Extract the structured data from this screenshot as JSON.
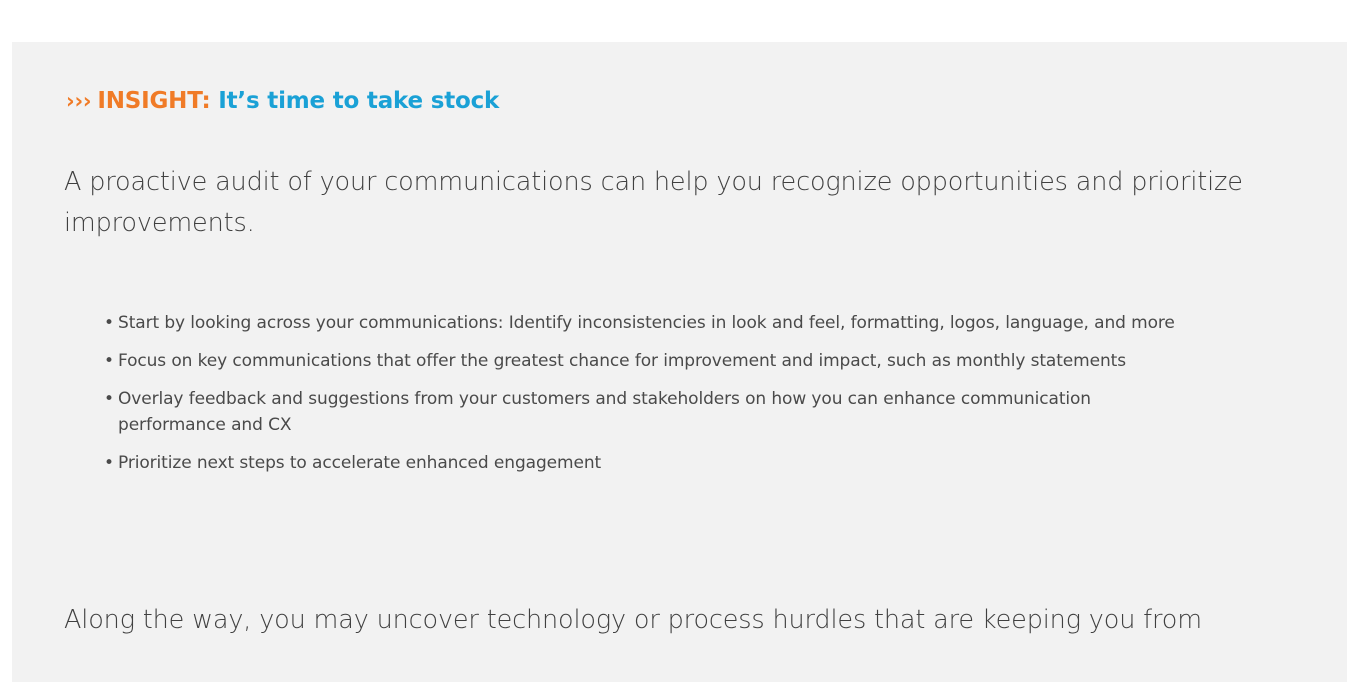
{
  "insight": {
    "chevrons": "›››",
    "label": "INSIGHT:",
    "title": "It’s time to take stock"
  },
  "intro": "A proactive audit of your communications can help you recognize opportunities and prioritize improvements.",
  "bullets": [
    {
      "marker": "•",
      "text": "Start by looking across your communications: Identify inconsistencies in look and feel, formatting, logos, language, and more"
    },
    {
      "marker": "•",
      "text": "Focus on key communications that offer the greatest chance for improvement and impact, such as monthly statements"
    },
    {
      "marker": "•",
      "text": "Overlay feedback and suggestions from your customers and stakeholders on how you can enhance communication performance and CX"
    },
    {
      "marker": "•",
      "text": "Prioritize next steps to accelerate enhanced engagement"
    }
  ],
  "outro": "Along the way, you may uncover technology or process hurdles that are keeping you from",
  "colors": {
    "accent_orange": "#f07b27",
    "accent_blue": "#1aa1d6",
    "panel_bg": "#f2f2f2",
    "body_text": "#404040"
  }
}
